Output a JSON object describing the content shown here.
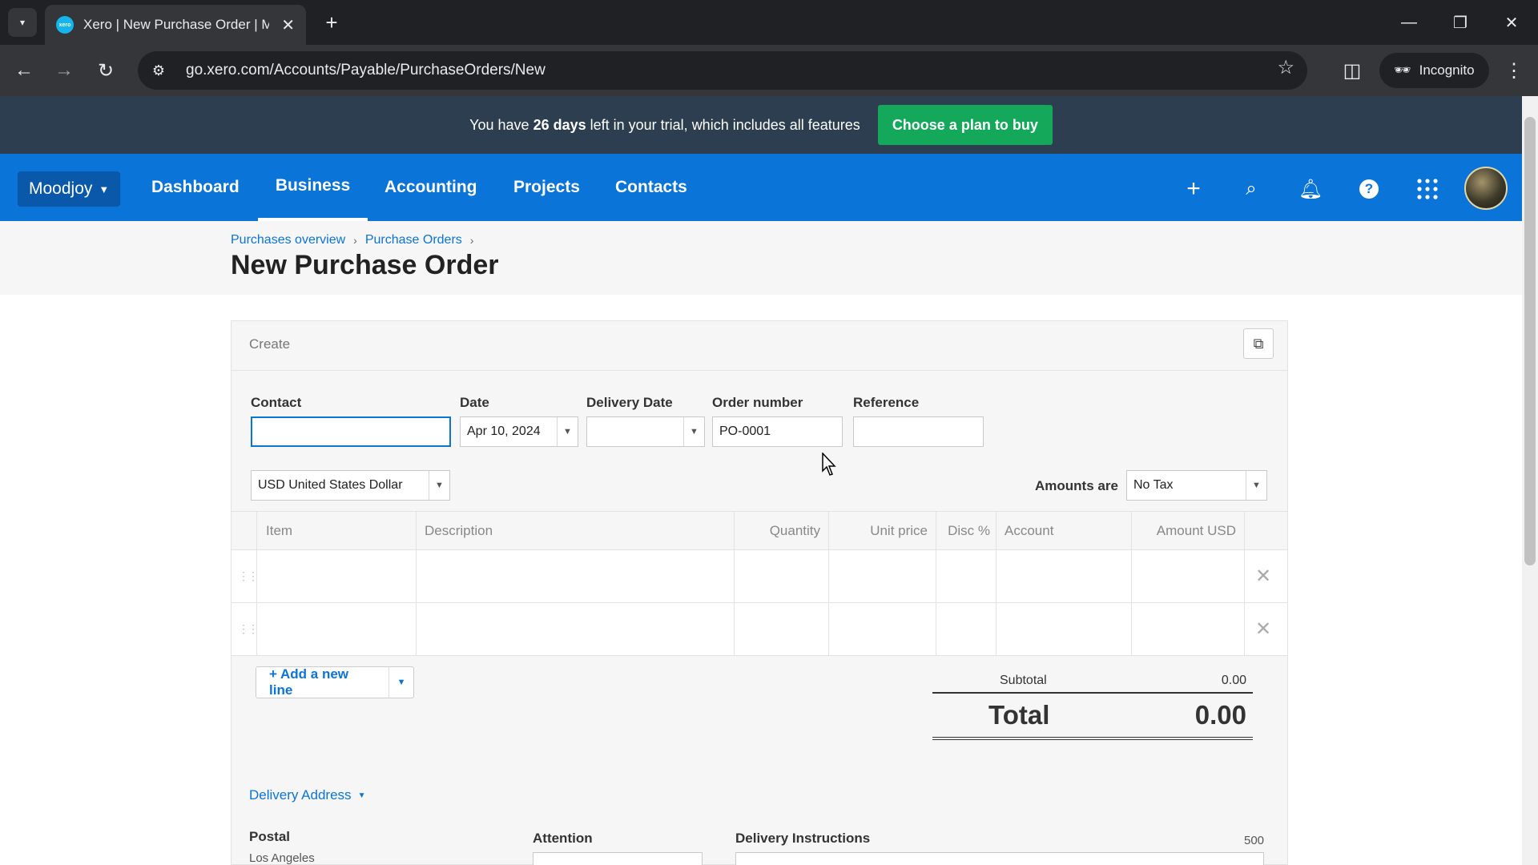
{
  "browser": {
    "tab_title": "Xero | New Purchase Order | M",
    "url": "go.xero.com/Accounts/Payable/PurchaseOrders/New",
    "incognito_label": "Incognito"
  },
  "trial": {
    "text_before": "You have ",
    "days": "26 days",
    "text_after": " left in your trial, which includes all features",
    "button": "Choose a plan to buy"
  },
  "nav": {
    "org": "Moodjoy",
    "links": [
      "Dashboard",
      "Business",
      "Accounting",
      "Projects",
      "Contacts"
    ],
    "active": "Business"
  },
  "breadcrumb": [
    "Purchases overview",
    "Purchase Orders"
  ],
  "page_title": "New Purchase Order",
  "form": {
    "section": "Create",
    "contact_label": "Contact",
    "contact_value": "",
    "date_label": "Date",
    "date_value": "Apr 10, 2024",
    "delivery_date_label": "Delivery Date",
    "delivery_date_value": "",
    "order_number_label": "Order number",
    "order_number_value": "PO-0001",
    "reference_label": "Reference",
    "reference_value": "",
    "currency": "USD United States Dollar",
    "amounts_are_label": "Amounts are",
    "amounts_are_value": "No Tax"
  },
  "table": {
    "columns": [
      "Item",
      "Description",
      "Quantity",
      "Unit price",
      "Disc %",
      "Account",
      "Amount USD"
    ],
    "rows": [
      {
        "item": "",
        "description": "",
        "quantity": "",
        "unit_price": "",
        "disc": "",
        "account": "",
        "amount": ""
      },
      {
        "item": "",
        "description": "",
        "quantity": "",
        "unit_price": "",
        "disc": "",
        "account": "",
        "amount": ""
      }
    ]
  },
  "add_line": "+ Add a new line",
  "totals": {
    "subtotal_label": "Subtotal",
    "subtotal_value": "0.00",
    "total_label": "Total",
    "total_value": "0.00"
  },
  "delivery": {
    "toggle": "Delivery Address",
    "postal_label": "Postal",
    "postal_value": "Los Angeles",
    "attention_label": "Attention",
    "instructions_label": "Delivery Instructions",
    "instructions_limit": "500"
  },
  "colors": {
    "xero_blue": "#0b74d8",
    "trial_bg": "#2c3e50",
    "trial_button": "#13a85a"
  }
}
